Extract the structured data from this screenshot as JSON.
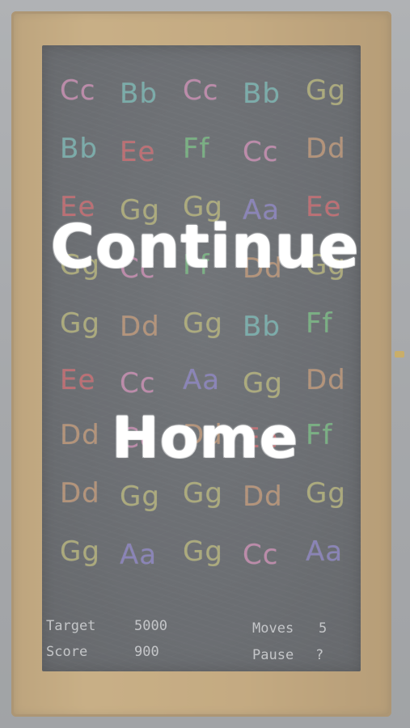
{
  "board": {
    "rows": [
      [
        {
          "t": "Cc",
          "c": "#c86aa0"
        },
        {
          "t": "Bb",
          "c": "#4fa7a0"
        },
        {
          "t": "Cc",
          "c": "#c86aa0"
        },
        {
          "t": "Bb",
          "c": "#4fa7a0"
        },
        {
          "t": "Gg",
          "c": "#a9a44c"
        }
      ],
      [
        {
          "t": "Bb",
          "c": "#4fa7a0"
        },
        {
          "t": "Ee",
          "c": "#c8363c"
        },
        {
          "t": "Ff",
          "c": "#4cae58"
        },
        {
          "t": "Cc",
          "c": "#c86aa0"
        },
        {
          "t": "Dd",
          "c": "#b87a48"
        }
      ],
      [
        {
          "t": "Ee",
          "c": "#c8363c"
        },
        {
          "t": "Gg",
          "c": "#a9a44c"
        },
        {
          "t": "Gg",
          "c": "#a9a44c"
        },
        {
          "t": "Aa",
          "c": "#6a5cb8"
        },
        {
          "t": "Ee",
          "c": "#c8363c"
        }
      ],
      [
        {
          "t": "Gg",
          "c": "#a9a44c"
        },
        {
          "t": "Cc",
          "c": "#c86aa0"
        },
        {
          "t": "Ff",
          "c": "#4cae58"
        },
        {
          "t": "Dd",
          "c": "#b87a48"
        },
        {
          "t": "Gg",
          "c": "#a9a44c"
        }
      ],
      [
        {
          "t": "Gg",
          "c": "#a9a44c"
        },
        {
          "t": "Dd",
          "c": "#b87a48"
        },
        {
          "t": "Gg",
          "c": "#a9a44c"
        },
        {
          "t": "Bb",
          "c": "#4fa7a0"
        },
        {
          "t": "Ff",
          "c": "#4cae58"
        }
      ],
      [
        {
          "t": "Ee",
          "c": "#c8363c"
        },
        {
          "t": "Cc",
          "c": "#c86aa0"
        },
        {
          "t": "Aa",
          "c": "#6a5cb8"
        },
        {
          "t": "Gg",
          "c": "#a9a44c"
        },
        {
          "t": "Dd",
          "c": "#b87a48"
        }
      ],
      [
        {
          "t": "Dd",
          "c": "#b87a48"
        },
        {
          "t": "Cc",
          "c": "#c86aa0"
        },
        {
          "t": "Dd",
          "c": "#b87a48"
        },
        {
          "t": "Ee",
          "c": "#c8363c"
        },
        {
          "t": "Ff",
          "c": "#4cae58"
        }
      ],
      [
        {
          "t": "Dd",
          "c": "#b87a48"
        },
        {
          "t": "Gg",
          "c": "#a9a44c"
        },
        {
          "t": "Gg",
          "c": "#a9a44c"
        },
        {
          "t": "Dd",
          "c": "#b87a48"
        },
        {
          "t": "Gg",
          "c": "#a9a44c"
        }
      ],
      [
        {
          "t": "Gg",
          "c": "#a9a44c"
        },
        {
          "t": "Aa",
          "c": "#6a5cb8"
        },
        {
          "t": "Gg",
          "c": "#a9a44c"
        },
        {
          "t": "Cc",
          "c": "#c86aa0"
        },
        {
          "t": "Aa",
          "c": "#6a5cb8"
        }
      ]
    ]
  },
  "hud": {
    "target_label": "Target",
    "target_value": "5000",
    "score_label": "Score",
    "score_value": "900",
    "moves_label": "Moves",
    "moves_value": "5",
    "pause_label": "Pause",
    "pause_value": "?"
  },
  "menu": {
    "continue_label": "Continue",
    "home_label": "Home"
  }
}
